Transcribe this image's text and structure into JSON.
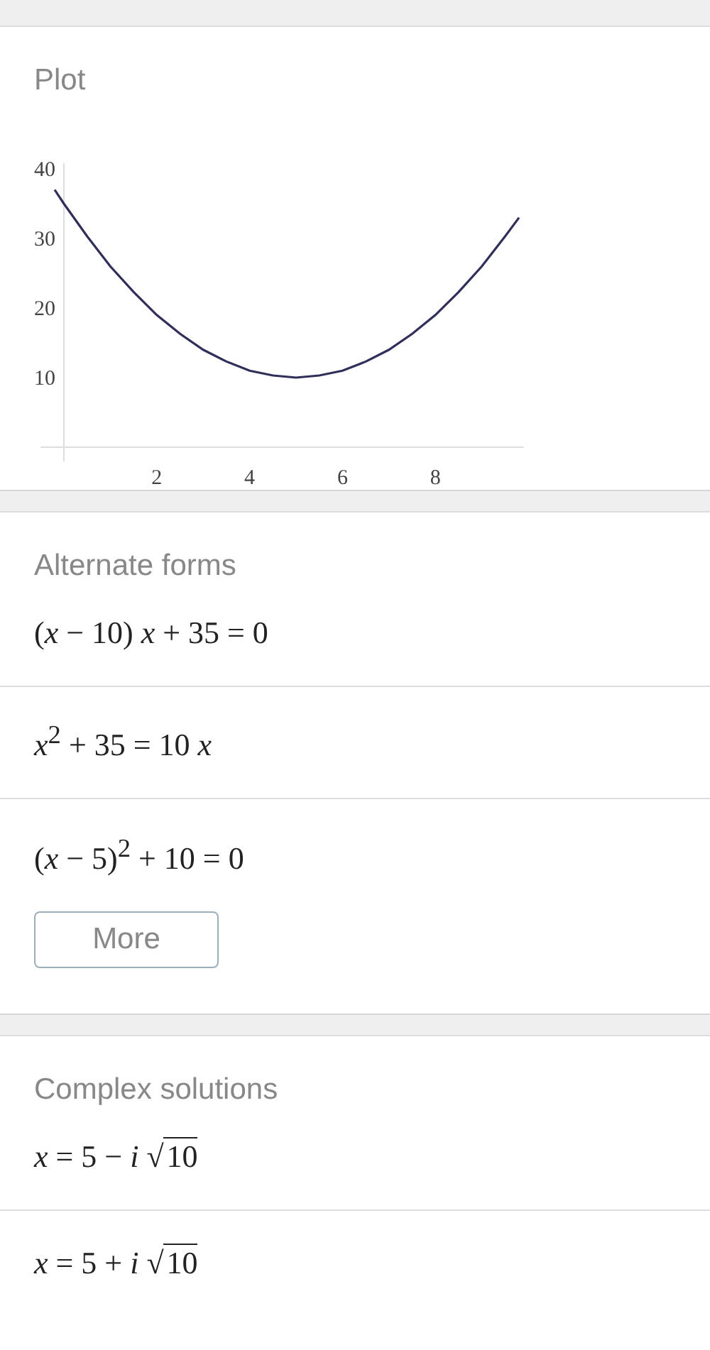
{
  "plot": {
    "title": "Plot",
    "chart_data": {
      "type": "line",
      "x": [
        -0.2,
        0,
        0.5,
        1,
        1.5,
        2,
        2.5,
        3,
        3.5,
        4,
        4.5,
        5,
        5.5,
        6,
        6.5,
        7,
        7.5,
        8,
        8.5,
        9,
        9.5,
        9.8
      ],
      "values": [
        37,
        35,
        30.3,
        26,
        22.3,
        19,
        16.3,
        14,
        12.3,
        11,
        10.3,
        10,
        10.3,
        11,
        12.3,
        14,
        16.3,
        19,
        22.3,
        26,
        30.3,
        33
      ],
      "xlim": [
        -0.5,
        9.9
      ],
      "ylim": [
        0,
        40
      ],
      "xticks": [
        2,
        4,
        6,
        8
      ],
      "yticks": [
        10,
        20,
        30,
        40
      ]
    }
  },
  "alternate_forms": {
    "title": "Alternate forms",
    "items": [
      "(*x* − 10) *x* + 35 = 0",
      "*x*$^{2}$ + 35 = 10 *x*",
      "(*x* − 5)$^{2}$ + 10 = 0"
    ],
    "more_button": "More"
  },
  "complex_solutions": {
    "title": "Complex solutions",
    "items": [
      {
        "text": "*x* = 5 − *i*",
        "radical": "√",
        "radicand": "10"
      },
      {
        "text": "*x* = 5 + *i*",
        "radical": "√",
        "radicand": "10"
      }
    ]
  }
}
